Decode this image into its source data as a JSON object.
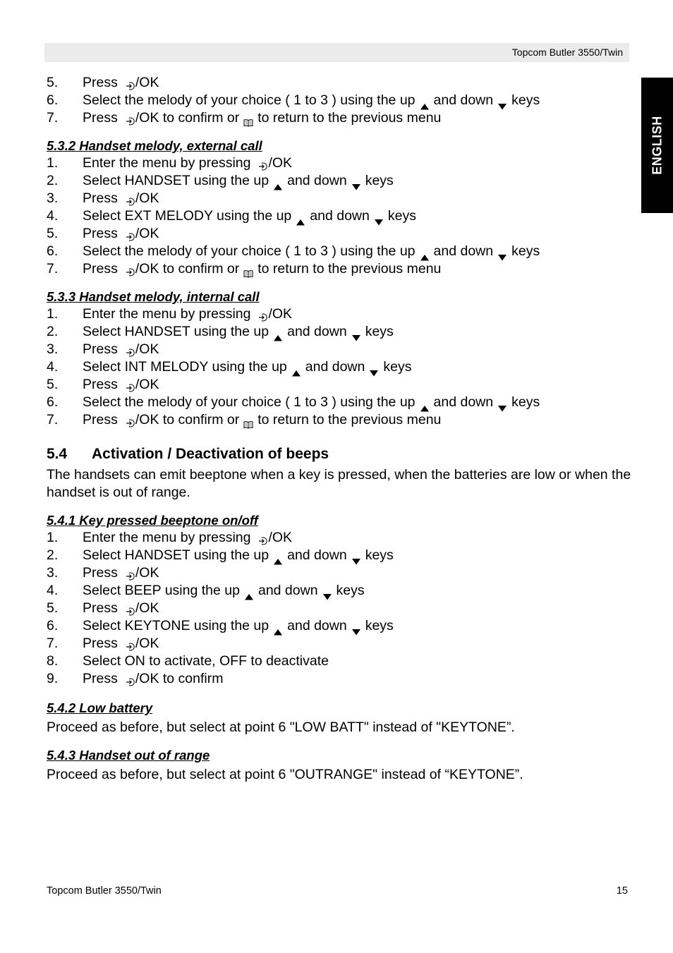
{
  "header": {
    "title": "Topcom Butler 3550/Twin"
  },
  "language_tab": {
    "label": "ENGLISH"
  },
  "intro_steps": [
    {
      "num": "5.",
      "parts": [
        "Press",
        "ok",
        "/OK"
      ]
    },
    {
      "num": "6.",
      "parts": [
        "Select the melody of your choice ( 1 to 3 ) using the up",
        "up",
        "and down",
        "down",
        "keys"
      ]
    },
    {
      "num": "7.",
      "parts": [
        "Press",
        "ok",
        "/OK to confirm or",
        "book",
        "to return to the previous menu"
      ]
    }
  ],
  "sections": [
    {
      "title": "5.3.2  Handset melody, external call",
      "steps": [
        {
          "num": "1.",
          "parts": [
            "Enter the menu by pressing",
            "ok",
            "/OK"
          ]
        },
        {
          "num": "2.",
          "parts": [
            "Select HANDSET using the up",
            "up",
            "and down",
            "down",
            "keys"
          ]
        },
        {
          "num": "3.",
          "parts": [
            "Press",
            "ok",
            "/OK"
          ]
        },
        {
          "num": "4.",
          "parts": [
            "Select EXT MELODY using the up",
            "up",
            "and down",
            "down",
            "keys"
          ]
        },
        {
          "num": "5.",
          "parts": [
            "Press",
            "ok",
            "/OK"
          ]
        },
        {
          "num": "6.",
          "parts": [
            "Select the melody of your choice ( 1 to 3 ) using the up",
            "up",
            "and down",
            "down",
            "keys"
          ]
        },
        {
          "num": "7.",
          "parts": [
            "Press",
            "ok",
            "/OK to confirm or",
            "book",
            "to return to the previous menu"
          ]
        }
      ]
    },
    {
      "title": "5.3.3  Handset melody, internal call",
      "steps": [
        {
          "num": "1.",
          "parts": [
            "Enter the menu by pressing",
            "ok",
            "/OK"
          ]
        },
        {
          "num": "2.",
          "parts": [
            "Select HANDSET using the up",
            "up",
            "and down",
            "down",
            "keys"
          ]
        },
        {
          "num": "3.",
          "parts": [
            "Press",
            "ok",
            "/OK"
          ]
        },
        {
          "num": "4.",
          "parts": [
            "Select INT MELODY using the up",
            "up",
            "and down",
            "down",
            "keys"
          ]
        },
        {
          "num": "5.",
          "parts": [
            "Press",
            "ok",
            "/OK"
          ]
        },
        {
          "num": "6.",
          "parts": [
            "Select the melody of your choice ( 1 to 3 ) using the up",
            "up",
            "and down",
            "down",
            "keys"
          ]
        },
        {
          "num": "7.",
          "parts": [
            "Press",
            "ok",
            "/OK to confirm or",
            "book",
            "to return to the previous menu"
          ]
        }
      ]
    }
  ],
  "section_5_4": {
    "number": "5.4",
    "title": "Activation / Deactivation of beeps",
    "intro": "The handsets can emit beeptone when a key is pressed, when the batteries are low or when the handset is out of range.",
    "sub_5_4_1": {
      "title": "5.4.1  Key pressed beeptone on/off",
      "steps": [
        {
          "num": "1.",
          "parts": [
            "Enter the menu by pressing",
            "ok",
            "/OK"
          ]
        },
        {
          "num": "2.",
          "parts": [
            "Select HANDSET using the up",
            "up",
            "and down",
            "down",
            "keys"
          ]
        },
        {
          "num": "3.",
          "parts": [
            "Press",
            "ok",
            "/OK"
          ]
        },
        {
          "num": "4.",
          "parts": [
            "Select BEEP using the up",
            "up",
            "and down",
            "down",
            "keys"
          ]
        },
        {
          "num": "5.",
          "parts": [
            "Press",
            "ok",
            "/OK"
          ]
        },
        {
          "num": "6.",
          "parts": [
            "Select KEYTONE using the up",
            "up",
            "and down",
            "down",
            "keys"
          ]
        },
        {
          "num": "7.",
          "parts": [
            "Press",
            "ok",
            "/OK"
          ]
        },
        {
          "num": "8.",
          "parts": [
            "Select ON to activate, OFF to deactivate"
          ]
        },
        {
          "num": "9.",
          "parts": [
            "Press",
            "ok",
            "/OK to confirm"
          ]
        }
      ]
    },
    "sub_5_4_2": {
      "title": "5.4.2  Low battery",
      "text": "Proceed as before, but select at point 6 \"LOW BATT\" instead of \"KEYTONE”."
    },
    "sub_5_4_3": {
      "title": "5.4.3  Handset out of range",
      "text": "Proceed as before, but select at point 6 \"OUTRANGE\" instead of “KEYTONE”."
    }
  },
  "footer": {
    "left": "Topcom Butler 3550/Twin",
    "page_number": "15"
  },
  "icons": {
    "ok": "menu-ok-icon",
    "book": "phonebook-icon",
    "up": "up-arrow-icon",
    "down": "down-arrow-icon"
  }
}
